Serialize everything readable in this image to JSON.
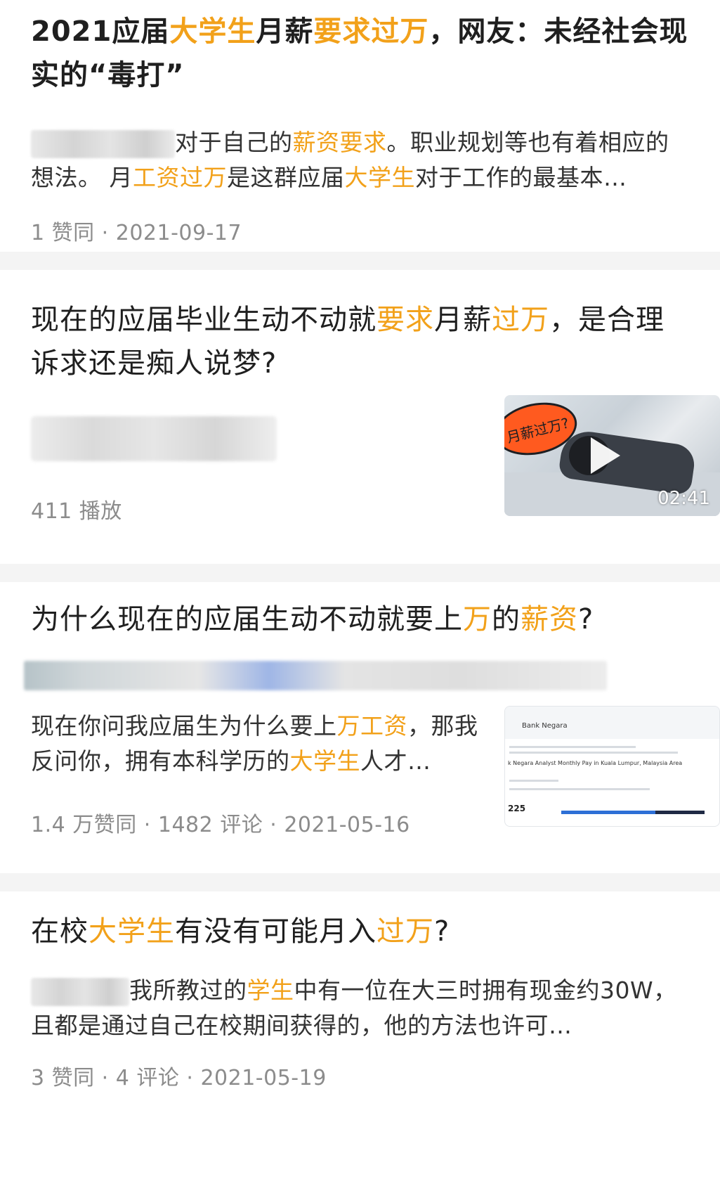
{
  "results": [
    {
      "title_parts": [
        {
          "t": "2021应届",
          "hl": false
        },
        {
          "t": "大学生",
          "hl": true
        },
        {
          "t": "月薪",
          "hl": false
        },
        {
          "t": "要求过万",
          "hl": true
        },
        {
          "t": "，网友：未经社会现实的“毒打”",
          "hl": false
        }
      ],
      "snippet_parts": [
        {
          "t": "对于自己的",
          "hl": false
        },
        {
          "t": "薪资要求",
          "hl": true
        },
        {
          "t": "。职业规划等也有着相应的想法。 月",
          "hl": false
        },
        {
          "t": "工资过万",
          "hl": true
        },
        {
          "t": "是这群应届",
          "hl": false
        },
        {
          "t": "大学生",
          "hl": true
        },
        {
          "t": "对于工作的最基本…",
          "hl": false
        }
      ],
      "meta": "1 赞同 · 2021-09-17"
    },
    {
      "title_parts": [
        {
          "t": "现在的应届毕业生动不动就",
          "hl": false
        },
        {
          "t": "要求",
          "hl": true
        },
        {
          "t": "月薪",
          "hl": false
        },
        {
          "t": "过万",
          "hl": true
        },
        {
          "t": "，是合理诉求还是痴人说梦?",
          "hl": false
        }
      ],
      "meta": "411 播放",
      "thumbnail": {
        "bubble_text": "月薪过万?",
        "duration": "02:41",
        "icon": "play-icon"
      }
    },
    {
      "title_parts": [
        {
          "t": "为什么现在的应届生动不动就要上",
          "hl": false
        },
        {
          "t": "万",
          "hl": true
        },
        {
          "t": "的",
          "hl": false
        },
        {
          "t": "薪资",
          "hl": true
        },
        {
          "t": "?",
          "hl": false
        }
      ],
      "snippet_parts": [
        {
          "t": "现在你问我应届生为什么要上",
          "hl": false
        },
        {
          "t": "万工资",
          "hl": true
        },
        {
          "t": "，那我反问你，拥有本科学历的",
          "hl": false
        },
        {
          "t": "大学生",
          "hl": true
        },
        {
          "t": "人才…",
          "hl": false
        }
      ],
      "meta": "1.4 万赞同 · 1482 评论 · 2021-05-16",
      "thumbnail": {
        "header": "Bank Negara",
        "caption": "k Negara Analyst Monthly Pay in Kuala Lumpur, Malaysia Area",
        "number": "225"
      }
    },
    {
      "title_parts": [
        {
          "t": "在校",
          "hl": false
        },
        {
          "t": "大学生",
          "hl": true
        },
        {
          "t": "有没有可能月入",
          "hl": false
        },
        {
          "t": "过万",
          "hl": true
        },
        {
          "t": "?",
          "hl": false
        }
      ],
      "snippet_parts": [
        {
          "t": "我所教过的",
          "hl": false
        },
        {
          "t": "学生",
          "hl": true
        },
        {
          "t": "中有一位在大三时拥有现金约30W，且都是通过自己在校期间获得的，他的方法也许可…",
          "hl": false
        }
      ],
      "meta": "3 赞同 · 4 评论 · 2021-05-19"
    }
  ]
}
